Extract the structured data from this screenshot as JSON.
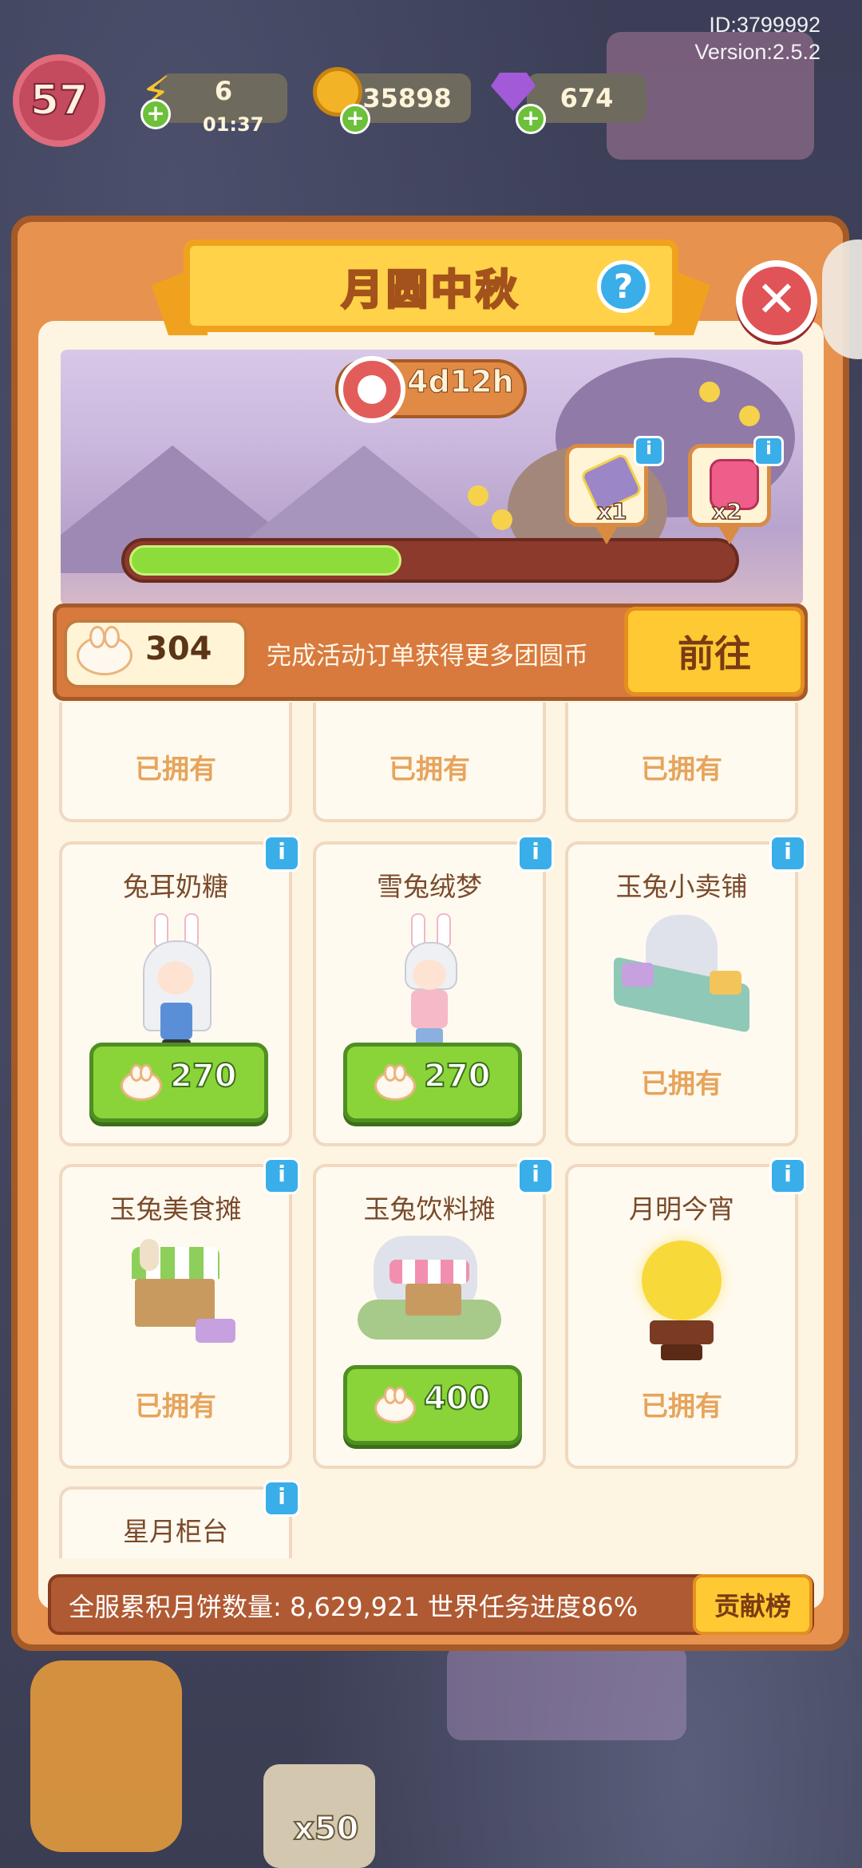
{
  "hud": {
    "id_text": "ID:3799992",
    "version_text": "Version:2.5.2",
    "level": "57",
    "energy": {
      "icon": "lightning-icon",
      "value": "6",
      "timer": "01:37"
    },
    "coins": {
      "icon": "gold-coin-icon",
      "value": "35898"
    },
    "gems": {
      "icon": "purple-gem-icon",
      "value": "674"
    }
  },
  "panel": {
    "title": "月圆中秋",
    "help_label": "?",
    "close_label": "✕",
    "timer": "4d12h",
    "progress_fraction": 0.45,
    "rewards": [
      {
        "icon": "scroll-item-icon",
        "count": "x1"
      },
      {
        "icon": "pink-backpack-icon",
        "count": "x2"
      }
    ]
  },
  "currency": {
    "icon": "bunny-coin-icon",
    "count": "304",
    "hint": "完成活动订单获得更多团圆币",
    "goto_label": "前往"
  },
  "items_top_row": [
    {
      "status": "已拥有"
    },
    {
      "status": "已拥有"
    },
    {
      "status": "已拥有"
    }
  ],
  "items": [
    {
      "name": "兔耳奶糖",
      "price": "270",
      "status": ""
    },
    {
      "name": "雪兔绒梦",
      "price": "270",
      "status": ""
    },
    {
      "name": "玉兔小卖铺",
      "price": "",
      "status": "已拥有"
    },
    {
      "name": "玉兔美食摊",
      "price": "",
      "status": "已拥有"
    },
    {
      "name": "玉兔饮料摊",
      "price": "400",
      "status": ""
    },
    {
      "name": "月明今宵",
      "price": "",
      "status": "已拥有"
    },
    {
      "name": "星月柜台",
      "price": "",
      "status": ""
    }
  ],
  "info_label": "i",
  "footer": {
    "text": "全服累积月饼数量: 8,629,921  世界任务进度86%",
    "rank_label": "贡献榜"
  },
  "background": {
    "multiplier_label": "x50"
  },
  "colors": {
    "panel": "#e7924f",
    "accent": "#ffc933",
    "buy_green": "#8ad43a",
    "info_blue": "#3aaee8",
    "close_red": "#e05356"
  }
}
